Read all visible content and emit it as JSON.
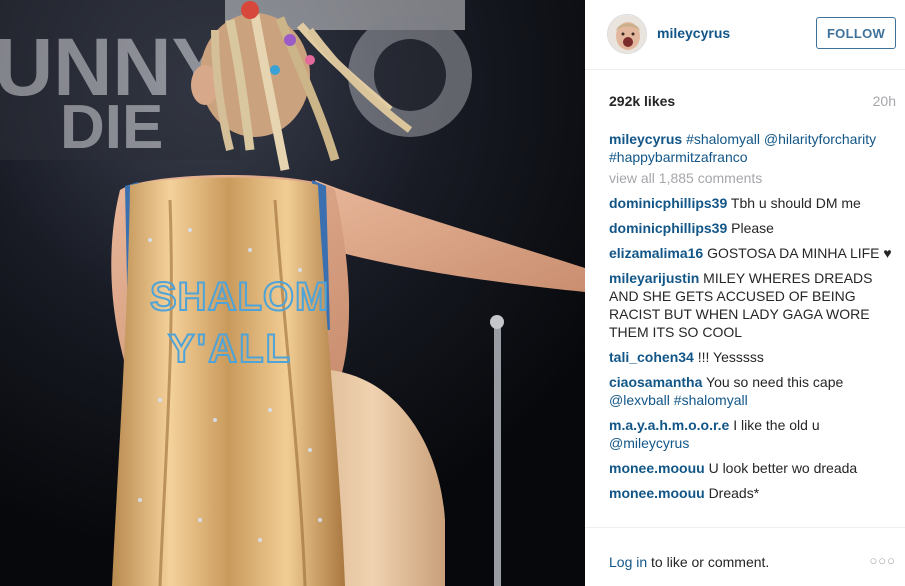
{
  "owner": {
    "username": "mileycyrus"
  },
  "follow_label": "FOLLOW",
  "likes": "292k likes",
  "age": "20h",
  "caption": {
    "user": "mileycyrus",
    "tag1": "#shalomyall",
    "tag2": "@hilarityforcharity",
    "tag3": "#happybarmitzafranco"
  },
  "view_all": "view all 1,885 comments",
  "comments": [
    {
      "user": "dominicphillips39",
      "text": "Tbh u should DM me"
    },
    {
      "user": "dominicphillips39",
      "text": "Please"
    },
    {
      "user": "elizamalima16",
      "text": "GOSTOSA DA MINHA LIFE ♥"
    },
    {
      "user": "mileyarijustin",
      "text": "MILEY WHERES DREADS AND SHE GETS ACCUSED OF BEING RACIST BUT WHEN LADY GAGA WORE THEM ITS SO COOL"
    },
    {
      "user": "tali_cohen34",
      "text": "!!! Yesssss"
    },
    {
      "user": "ciaosamantha",
      "text": "You so need this cape",
      "tag1": "@lexvball",
      "tag2": "#shalomyall"
    },
    {
      "user": "m.a.y.a.h.m.o.o.r.e",
      "text": "I like the old u",
      "tag1": "@mileycyrus"
    },
    {
      "user": "monee.moouu",
      "text": "U look better wo dreada"
    },
    {
      "user": "monee.moouu",
      "text": "Dreads*"
    }
  ],
  "footer": {
    "login": "Log in",
    "rest": " to like or comment.",
    "more": "○○○"
  },
  "photo": {
    "backdrop_text_1": "UNNY",
    "backdrop_text_2": "DIE",
    "cape_text_1": "SHALOM",
    "cape_text_2": "Y'ALL"
  },
  "colors": {
    "link": "#125688",
    "follow": "#3f729b",
    "muted": "#a5a7aa"
  }
}
